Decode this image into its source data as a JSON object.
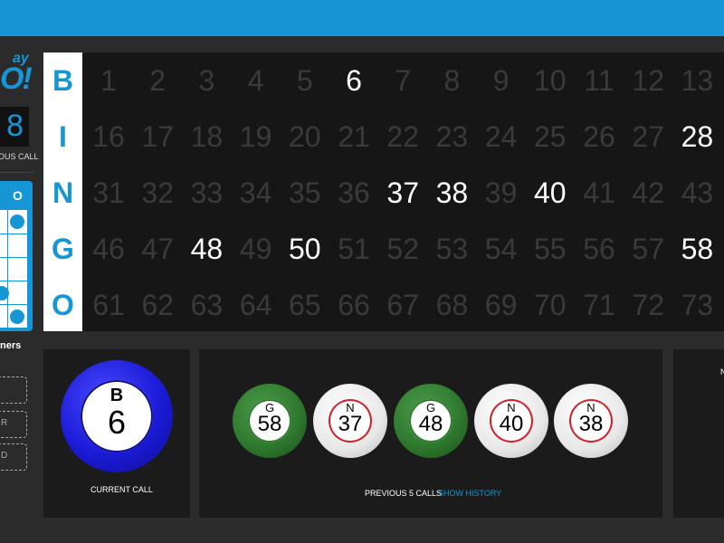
{
  "app": {
    "logo_line1": "ay",
    "logo_line2": "O!"
  },
  "sidebar": {
    "count": "8",
    "previous_call_label": "OUS CALL",
    "card_header": "O",
    "patterns_label": "ners",
    "pattern_items": [
      "",
      "R",
      "D"
    ]
  },
  "board": {
    "letters": [
      "B",
      "I",
      "N",
      "G",
      "O"
    ],
    "rows": [
      [
        1,
        2,
        3,
        4,
        5,
        6,
        7,
        8,
        9,
        10,
        11,
        12,
        13
      ],
      [
        16,
        17,
        18,
        19,
        20,
        21,
        22,
        23,
        24,
        25,
        26,
        27,
        28
      ],
      [
        31,
        32,
        33,
        34,
        35,
        36,
        37,
        38,
        39,
        40,
        41,
        42,
        43
      ],
      [
        46,
        47,
        48,
        49,
        50,
        51,
        52,
        53,
        54,
        55,
        56,
        57,
        58
      ],
      [
        61,
        62,
        63,
        64,
        65,
        66,
        67,
        68,
        69,
        70,
        71,
        72,
        73
      ]
    ],
    "called": [
      6,
      28,
      37,
      38,
      40,
      48,
      50,
      58
    ]
  },
  "current_call": {
    "letter": "B",
    "number": "6",
    "label": "CURRENT CALL"
  },
  "previous_calls": {
    "label": "PREVIOUS 5 CALLS",
    "show_history": "SHOW HISTORY",
    "balls": [
      {
        "letter": "G",
        "number": "58",
        "color": "green",
        "ring": "#2f7a2f"
      },
      {
        "letter": "N",
        "number": "37",
        "color": "white",
        "ring": "#d0202a"
      },
      {
        "letter": "G",
        "number": "48",
        "color": "green",
        "ring": "#2f7a2f"
      },
      {
        "letter": "N",
        "number": "40",
        "color": "white",
        "ring": "#d0202a"
      },
      {
        "letter": "N",
        "number": "38",
        "color": "white",
        "ring": "#d0202a"
      }
    ]
  },
  "right_panel": {
    "text": "N"
  },
  "colors": {
    "accent": "#1796d6",
    "board_bg": "#161616",
    "called_number": "#ffffff",
    "uncalled_number": "#3a3a3a"
  }
}
